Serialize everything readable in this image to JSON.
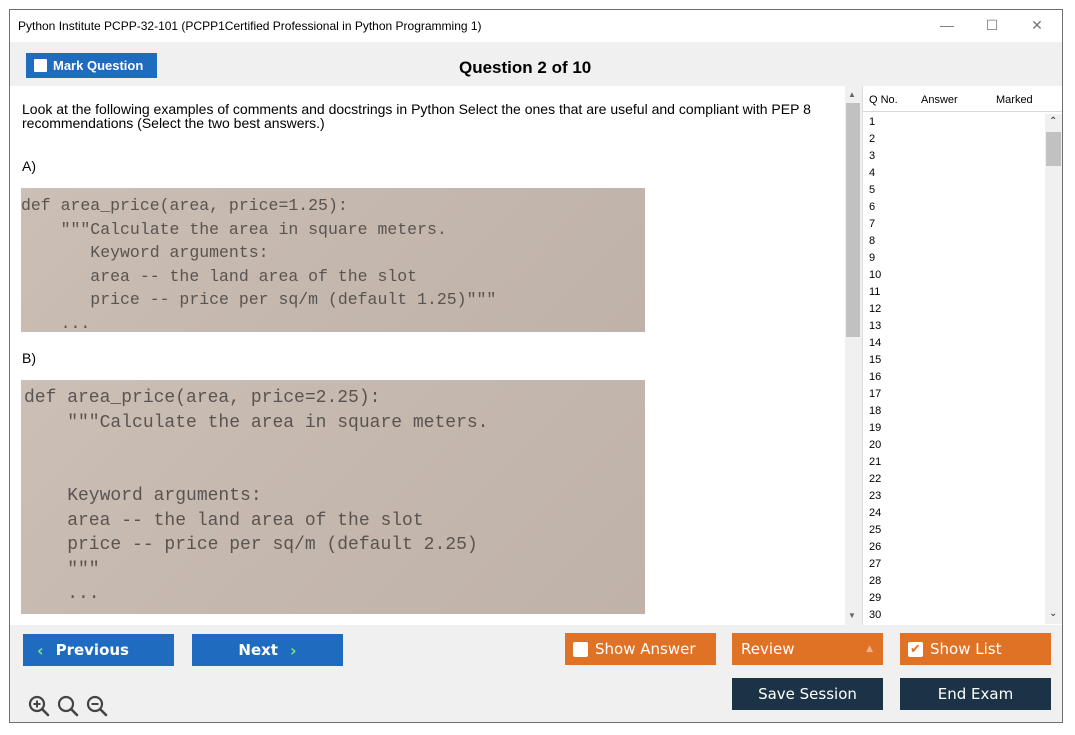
{
  "window": {
    "title": "Python Institute PCPP-32-101 (PCPP1Certified Professional in Python Programming 1)",
    "controls": {
      "minimize": "—",
      "maximize": "☐",
      "close": "✕"
    }
  },
  "header": {
    "mark_label": "Mark Question",
    "question_counter": "Question 2 of 10"
  },
  "question": {
    "text": "Look at the following examples of comments and docstrings in Python Select the ones that are useful and compliant with PEP 8 recommendations (Select the two best answers.)",
    "options": [
      {
        "label": "A)",
        "code_lines": [
          "def area_price(area, price=1.25):",
          "    \"\"\"Calculate the area in square meters.",
          "       Keyword arguments:",
          "       area -- the land area of the slot",
          "       price -- price per sq/m (default 1.25)\"\"\"",
          "    ..."
        ]
      },
      {
        "label": "B)",
        "code_lines": [
          "def area_price(area, price=2.25):",
          "    \"\"\"Calculate the area in square meters.",
          "",
          "",
          "    Keyword arguments:",
          "    area -- the land area of the slot",
          "    price -- price per sq/m (default 2.25)",
          "    \"\"\"",
          "    ..."
        ]
      }
    ]
  },
  "question_list": {
    "headers": {
      "qno": "Q No.",
      "answer": "Answer",
      "marked": "Marked"
    },
    "numbers": [
      "1",
      "2",
      "3",
      "4",
      "5",
      "6",
      "7",
      "8",
      "9",
      "10",
      "11",
      "12",
      "13",
      "14",
      "15",
      "16",
      "17",
      "18",
      "19",
      "20",
      "21",
      "22",
      "23",
      "24",
      "25",
      "26",
      "27",
      "28",
      "29",
      "30"
    ]
  },
  "footer": {
    "previous_label": "Previous",
    "next_label": "Next",
    "show_answer_label": "Show Answer",
    "review_label": "Review",
    "show_list_label": "Show List",
    "save_session_label": "Save Session",
    "end_exam_label": "End Exam"
  },
  "icons": {
    "zoom_in": "zoom-in-icon",
    "zoom_reset": "zoom-reset-icon",
    "zoom_out": "zoom-out-icon"
  },
  "colors": {
    "blue": "#1f6bbf",
    "orange": "#e07225",
    "dark": "#1c3347"
  }
}
